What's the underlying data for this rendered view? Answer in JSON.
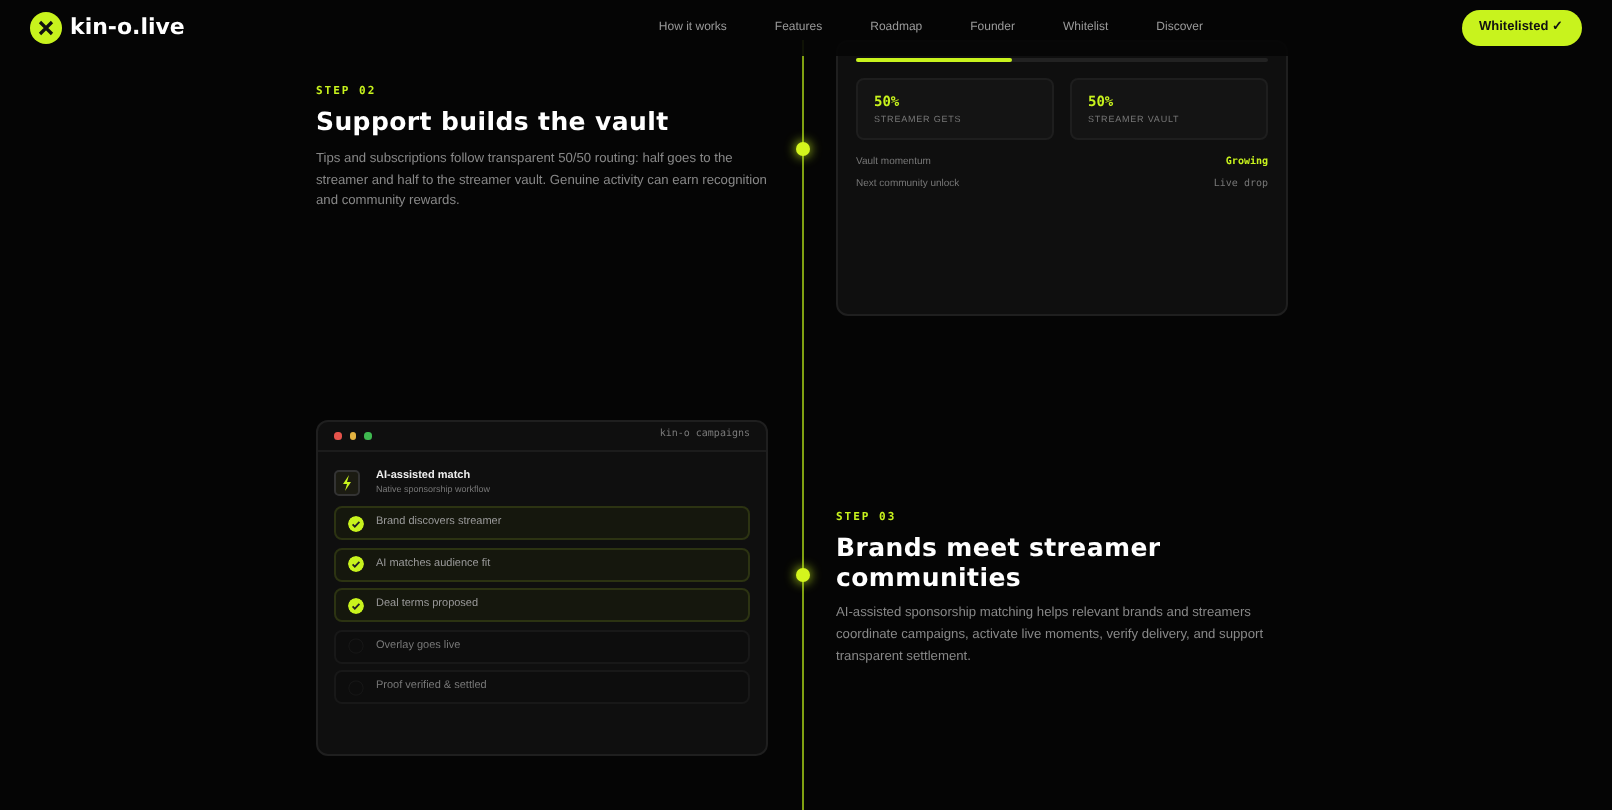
{
  "nav": {
    "brand": "kin-o.live",
    "links": [
      "How it works",
      "Features",
      "Roadmap",
      "Founder",
      "Whitelist",
      "Discover"
    ],
    "cta": "Whitelisted ✓"
  },
  "step2": {
    "step": "STEP 02",
    "title": "Support builds the vault",
    "body": "Tips and subscriptions follow transparent 50/50 routing: half goes to the streamer and half to the streamer vault. Genuine activity can earn recognition and community rewards.",
    "vault": {
      "level": 0.38,
      "stats": [
        {
          "value": "50%",
          "label": "STREAMER GETS"
        },
        {
          "value": "50%",
          "label": "STREAMER VAULT"
        }
      ],
      "rows": [
        {
          "label": "Vault momentum",
          "value": "Growing",
          "highlight": true
        },
        {
          "label": "Next community unlock",
          "value": "Live drop",
          "highlight": false
        }
      ]
    }
  },
  "step3": {
    "step": "STEP 03",
    "title": "Brands meet streamer communities",
    "body": "AI-assisted sponsorship matching helps relevant brands and streamers coordinate campaigns, activate live moments, verify delivery, and support transparent settlement.",
    "window": {
      "title": "kin-o campaigns",
      "match_title": "AI-assisted match",
      "match_sub": "Native sponsorship workflow",
      "steps": [
        {
          "label": "Brand discovers streamer",
          "checked": true
        },
        {
          "label": "AI matches audience fit",
          "checked": true
        },
        {
          "label": "Deal terms proposed",
          "checked": true
        },
        {
          "label": "Overlay goes live",
          "checked": false
        },
        {
          "label": "Proof verified & settled",
          "checked": false
        }
      ]
    }
  }
}
